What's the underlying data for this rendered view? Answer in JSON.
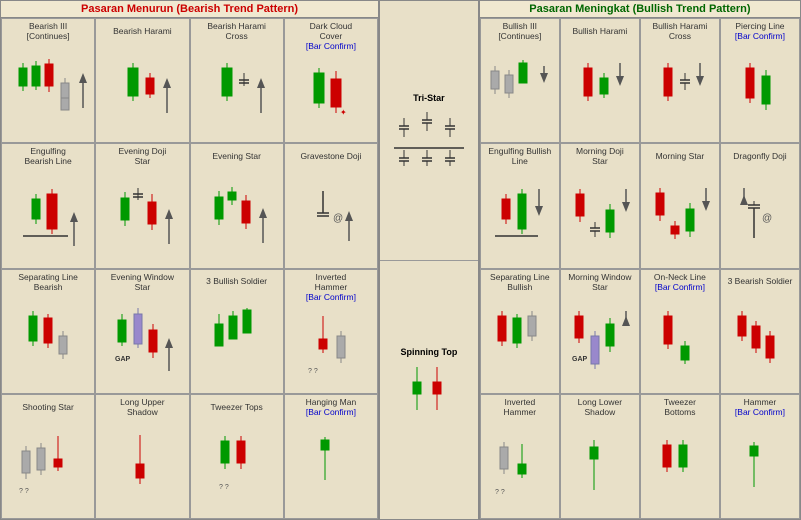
{
  "bearish": {
    "header": "Pasaran Menurun (Bearish Trend Pattern)",
    "patterns": [
      {
        "name": "Bearish III\n[Continues]",
        "confirm": false,
        "type": "bearish-3-continues"
      },
      {
        "name": "Bearish Harami",
        "confirm": false,
        "type": "bearish-harami"
      },
      {
        "name": "Bearish Harami\nCross",
        "confirm": false,
        "type": "bearish-harami-cross"
      },
      {
        "name": "Dark Cloud\nCover",
        "confirm": true,
        "type": "dark-cloud-cover"
      },
      {
        "name": "Engulfing\nBearish Line",
        "confirm": false,
        "type": "engulfing-bearish"
      },
      {
        "name": "Evening Doji\nStar",
        "confirm": false,
        "type": "evening-doji"
      },
      {
        "name": "Evening Star",
        "confirm": false,
        "type": "evening-star"
      },
      {
        "name": "Gravestone Doji",
        "confirm": false,
        "type": "gravestone-doji"
      },
      {
        "name": "Separating Line\nBearish",
        "confirm": false,
        "type": "separating-bearish"
      },
      {
        "name": "Evening Window\nStar",
        "confirm": false,
        "type": "evening-window"
      },
      {
        "name": "3 Bullish Soldier",
        "confirm": false,
        "type": "3-bullish-soldier"
      },
      {
        "name": "Inverted\nHammer",
        "confirm": true,
        "type": "inverted-hammer-b"
      },
      {
        "name": "Shooting Star",
        "confirm": false,
        "type": "shooting-star"
      },
      {
        "name": "Long Upper\nShadow",
        "confirm": false,
        "type": "long-upper-shadow"
      },
      {
        "name": "Tweezer Tops",
        "confirm": false,
        "type": "tweezer-tops"
      },
      {
        "name": "Hanging Man",
        "confirm": true,
        "type": "hanging-man"
      }
    ]
  },
  "middle": {
    "tristar": "Tri-Star",
    "spinningtop": "Spinning Top"
  },
  "bullish": {
    "header": "Pasaran Meningkat (Bullish Trend Pattern)",
    "patterns": [
      {
        "name": "Bullish III\n[Continues]",
        "confirm": false,
        "type": "bullish-3-continues"
      },
      {
        "name": "Bullish Harami",
        "confirm": false,
        "type": "bullish-harami"
      },
      {
        "name": "Bullish Harami\nCross",
        "confirm": false,
        "type": "bullish-harami-cross"
      },
      {
        "name": "Piercing Line",
        "confirm": true,
        "type": "piercing-line"
      },
      {
        "name": "Engulfing Bullish\nLine",
        "confirm": false,
        "type": "engulfing-bullish"
      },
      {
        "name": "Morning Doji\nStar",
        "confirm": false,
        "type": "morning-doji"
      },
      {
        "name": "Morning Star",
        "confirm": false,
        "type": "morning-star"
      },
      {
        "name": "Dragonfly Doji",
        "confirm": false,
        "type": "dragonfly-doji"
      },
      {
        "name": "Separating Line\nBullish",
        "confirm": false,
        "type": "separating-bullish"
      },
      {
        "name": "Morning Window\nStar",
        "confirm": false,
        "type": "morning-window"
      },
      {
        "name": "On-Neck Line",
        "confirm": true,
        "type": "on-neck"
      },
      {
        "name": "3 Bearish Soldier",
        "confirm": false,
        "type": "3-bearish-soldier"
      },
      {
        "name": "Inverted\nHammer",
        "confirm": false,
        "type": "inverted-hammer"
      },
      {
        "name": "Long Lower\nShadow",
        "confirm": false,
        "type": "long-lower-shadow"
      },
      {
        "name": "Tweezer\nBottoms",
        "confirm": false,
        "type": "tweezer-bottoms"
      },
      {
        "name": "Hammer",
        "confirm": true,
        "type": "hammer"
      }
    ]
  }
}
